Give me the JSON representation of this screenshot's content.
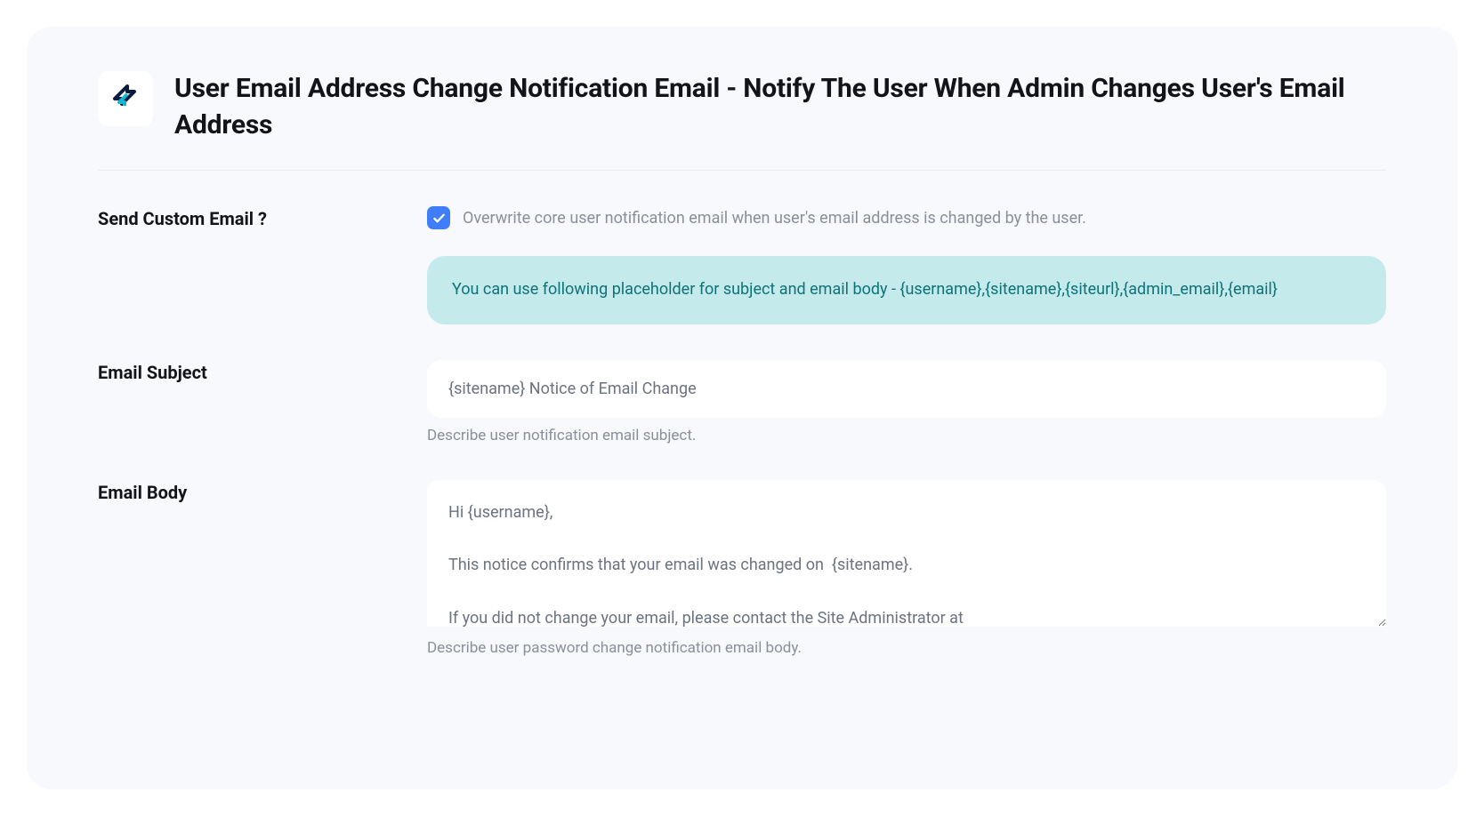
{
  "header": {
    "title": "User Email Address Change Notification Email - Notify The User When Admin Changes User's Email Address"
  },
  "form": {
    "send_custom_email": {
      "label": "Send Custom Email ?",
      "checkbox_label": "Overwrite core user notification email when user's email address is changed by the user.",
      "checked": true,
      "info": "You can use following placeholder for subject and email body - {username},{sitename},{siteurl},{admin_email},{email}"
    },
    "email_subject": {
      "label": "Email Subject",
      "value": "{sitename} Notice of Email Change",
      "helper": "Describe user notification email subject."
    },
    "email_body": {
      "label": "Email Body",
      "value": "Hi {username},\n\nThis notice confirms that your email was changed on  {sitename}.\n\nIf you did not change your email, please contact the Site Administrator at\n{admin_email}",
      "helper": "Describe user password change notification email body."
    }
  }
}
